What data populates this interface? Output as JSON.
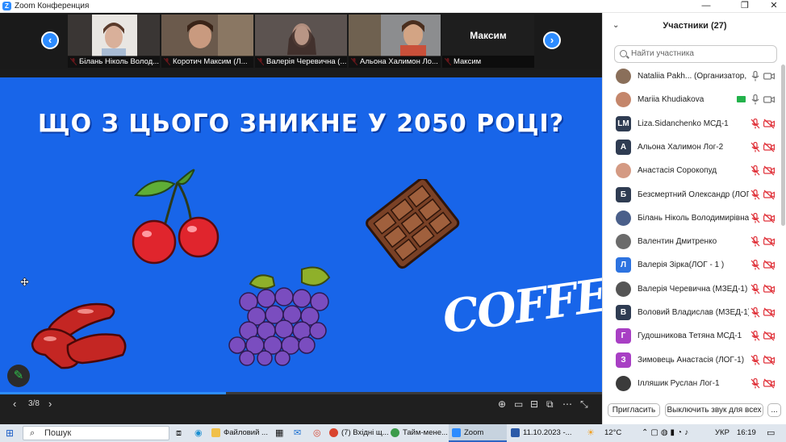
{
  "window": {
    "title": "Zoom Конференция"
  },
  "thumbnails": [
    {
      "name": "Білань Ніколь Волод..."
    },
    {
      "name": "Коротич Максим (Л..."
    },
    {
      "name": "Валерія Черевична (..."
    },
    {
      "name": "Альона Халимон Ло..."
    },
    {
      "name": "Максим",
      "big_name": "Максим"
    }
  ],
  "slide": {
    "title": "ЩО З ЦЬОГО ЗНИКНЕ У 2050 РОЦІ?",
    "coffee_word": "COFFEE",
    "page": "3/8",
    "progress_fraction": 0.375
  },
  "panel": {
    "title": "Участники (27)",
    "search_placeholder": "Найти участника",
    "participants": [
      {
        "name": "Nataliia Pakh... (Организатор, я)",
        "initials": "",
        "color": "#8a6f5a"
      },
      {
        "name": "Mariia Khudiakova",
        "initials": "",
        "color": "#c4866b"
      },
      {
        "name": "Liza.Sidanchenko МСД-1",
        "initials": "LM",
        "color": "#2f3c52"
      },
      {
        "name": "Альона Халимон Лог-2",
        "initials": "А",
        "color": "#2f3c52"
      },
      {
        "name": "Анастасія Сорокопуд",
        "initials": "",
        "color": "#d49a83"
      },
      {
        "name": "Безсмертний Олександр (ЛОГ...",
        "initials": "Б",
        "color": "#2f3c52"
      },
      {
        "name": "Білань Ніколь Володимирівна ...",
        "initials": "",
        "color": "#4a5f8a"
      },
      {
        "name": "Валентин Дмитренко",
        "initials": "",
        "color": "#6b6b6b"
      },
      {
        "name": "Валерія Зірка(ЛОГ - 1 )",
        "initials": "Л",
        "color": "#2d73e0"
      },
      {
        "name": "Валерія Черевична (МЗЕД-1)",
        "initials": "",
        "color": "#555555"
      },
      {
        "name": "Воловий Владислав (МЗЕД-1)",
        "initials": "В",
        "color": "#2f3c52"
      },
      {
        "name": "Гудошникова Тетяна МСД-1",
        "initials": "Г",
        "color": "#a83fc4"
      },
      {
        "name": "Зимовець Анастасія (ЛОГ-1)",
        "initials": "З",
        "color": "#a83fc4"
      },
      {
        "name": "Ілляшик Руслан Лог-1",
        "initials": "",
        "color": "#3b3b3b"
      }
    ],
    "invite_label": "Пригласить",
    "mute_all_label": "Выключить звук для всех",
    "more_label": "..."
  },
  "taskbar": {
    "search_label": "Пошук",
    "apps": [
      {
        "label": "Файловий ..."
      },
      {
        "label": "(7) Вхідні щ..."
      },
      {
        "label": "Тайм-мене..."
      },
      {
        "label": "Zoom"
      },
      {
        "label": "11.10.2023 -..."
      }
    ],
    "temperature": "12°C",
    "language": "УКР",
    "time": "16:19"
  },
  "colors": {
    "accent": "#2d8cff",
    "slide_bg": "#1865e9",
    "muted": "#e0323a"
  }
}
